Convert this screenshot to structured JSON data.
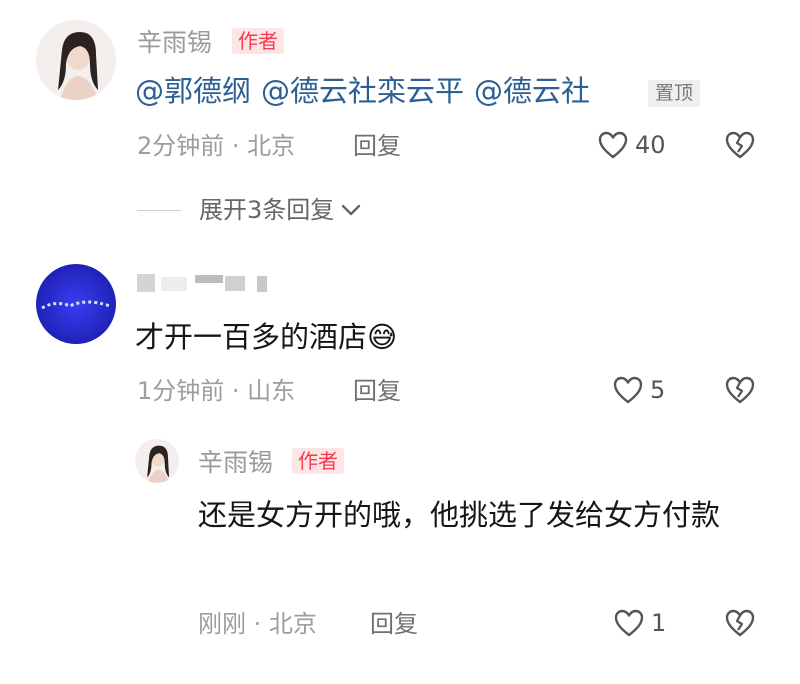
{
  "comments": [
    {
      "author": "辛雨锡",
      "author_tag": "作者",
      "mentions": [
        "@郭德纲",
        "@德云社栾云平",
        "@德云社"
      ],
      "pin_tag": "置顶",
      "time_location": "2分钟前 · 北京",
      "reply_label": "回复",
      "likes": "40",
      "expand_label": "展开3条回复"
    },
    {
      "text": "才开一百多的酒店",
      "emoji": "😅",
      "time_location": "1分钟前 · 山东",
      "reply_label": "回复",
      "likes": "5",
      "reply": {
        "author": "辛雨锡",
        "author_tag": "作者",
        "text": "还是女方开的哦，他挑选了发给女方付款",
        "time_location": "刚刚 · 北京",
        "reply_label": "回复",
        "likes": "1"
      }
    }
  ],
  "icons": {
    "like": "heart-outline-icon",
    "dislike": "broken-heart-icon",
    "expand": "chevron-down-icon"
  }
}
